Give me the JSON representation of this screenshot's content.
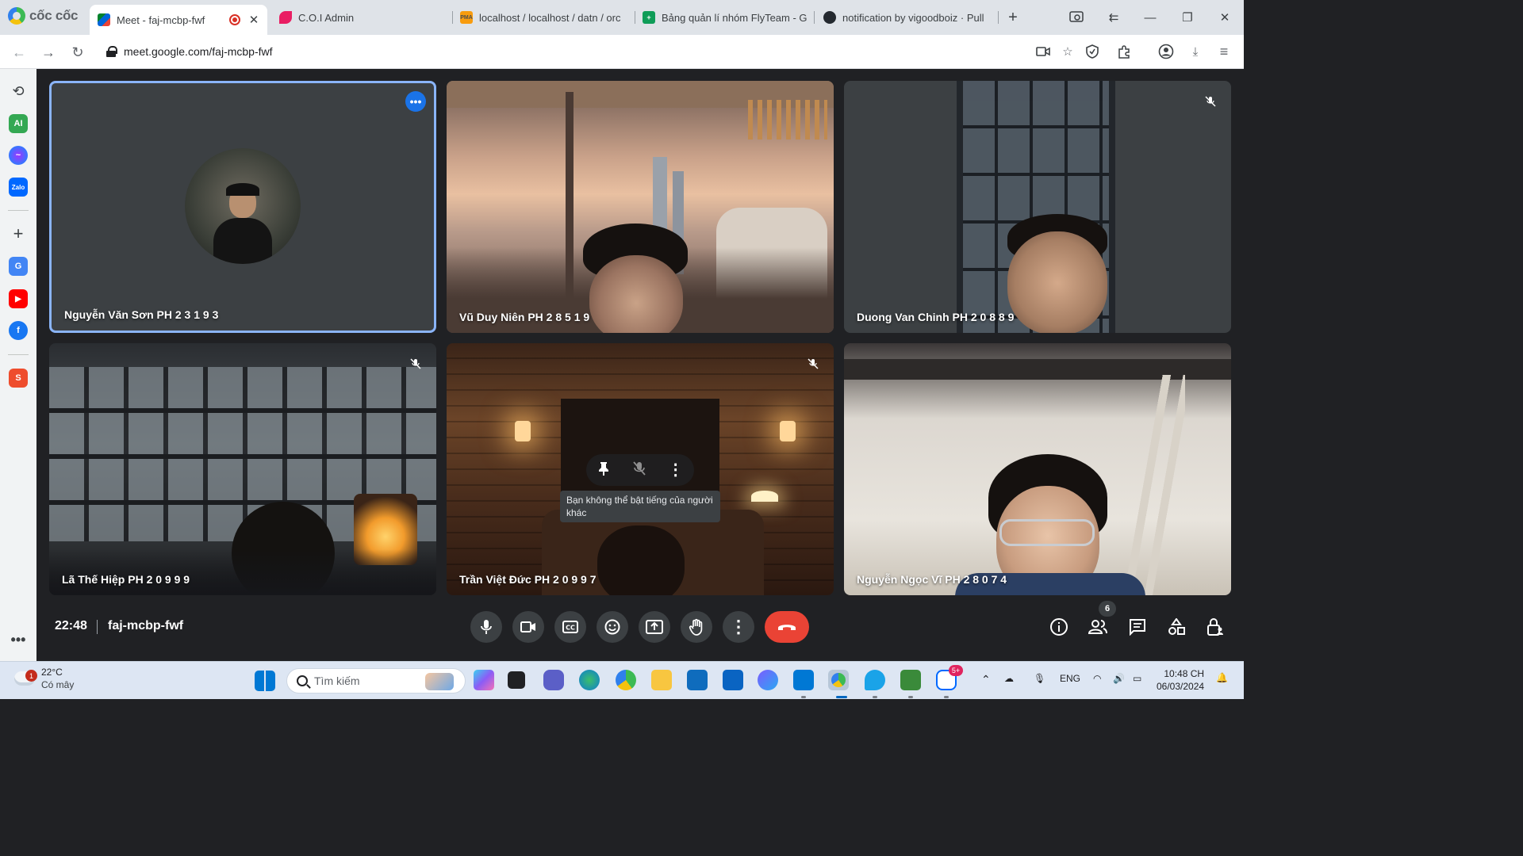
{
  "browser": {
    "brand": "cốc cốc",
    "tabs": [
      {
        "title": "Meet - faj-mcbp-fwf",
        "active": true
      },
      {
        "title": "C.O.I Admin"
      },
      {
        "title": "localhost / localhost / datn / orc"
      },
      {
        "title": "Bảng quản lí nhóm FlyTeam - G"
      },
      {
        "title": "notification by vigoodboiz · Pull"
      }
    ],
    "new_tab": "+",
    "url": "meet.google.com/faj-mcbp-fwf"
  },
  "meet": {
    "tiles": [
      {
        "name": "Nguyễn Văn Sơn PH 2 3 1 9 3",
        "active_speaker": true
      },
      {
        "name": "Vũ Duy Niên PH 2 8 5 1 9"
      },
      {
        "name": "Duong Van Chinh PH 2 0 8 8 9",
        "muted": true
      },
      {
        "name": "Lã Thế Hiệp PH 2 0 9 9 9",
        "muted": true
      },
      {
        "name": "Trần Việt Đức PH 2 0 9 9 7",
        "muted": true
      },
      {
        "name": "Nguyễn Ngọc Vĩ PH 2 8 0 7 4"
      }
    ],
    "tooltip": "Bạn không thể bật tiếng của người khác",
    "time": "22:48",
    "meeting_code": "faj-mcbp-fwf",
    "participants_count": "6",
    "accent_end_call": "#ea4335",
    "accent_active": "#8ab4f8"
  },
  "taskbar": {
    "weather_temp": "22°C",
    "weather_desc": "Có mây",
    "weather_badge": "1",
    "search_placeholder": "Tìm kiếm",
    "language": "ENG",
    "clock_time": "10:48 CH",
    "clock_date": "06/03/2024",
    "zalo_badge": "5+"
  }
}
